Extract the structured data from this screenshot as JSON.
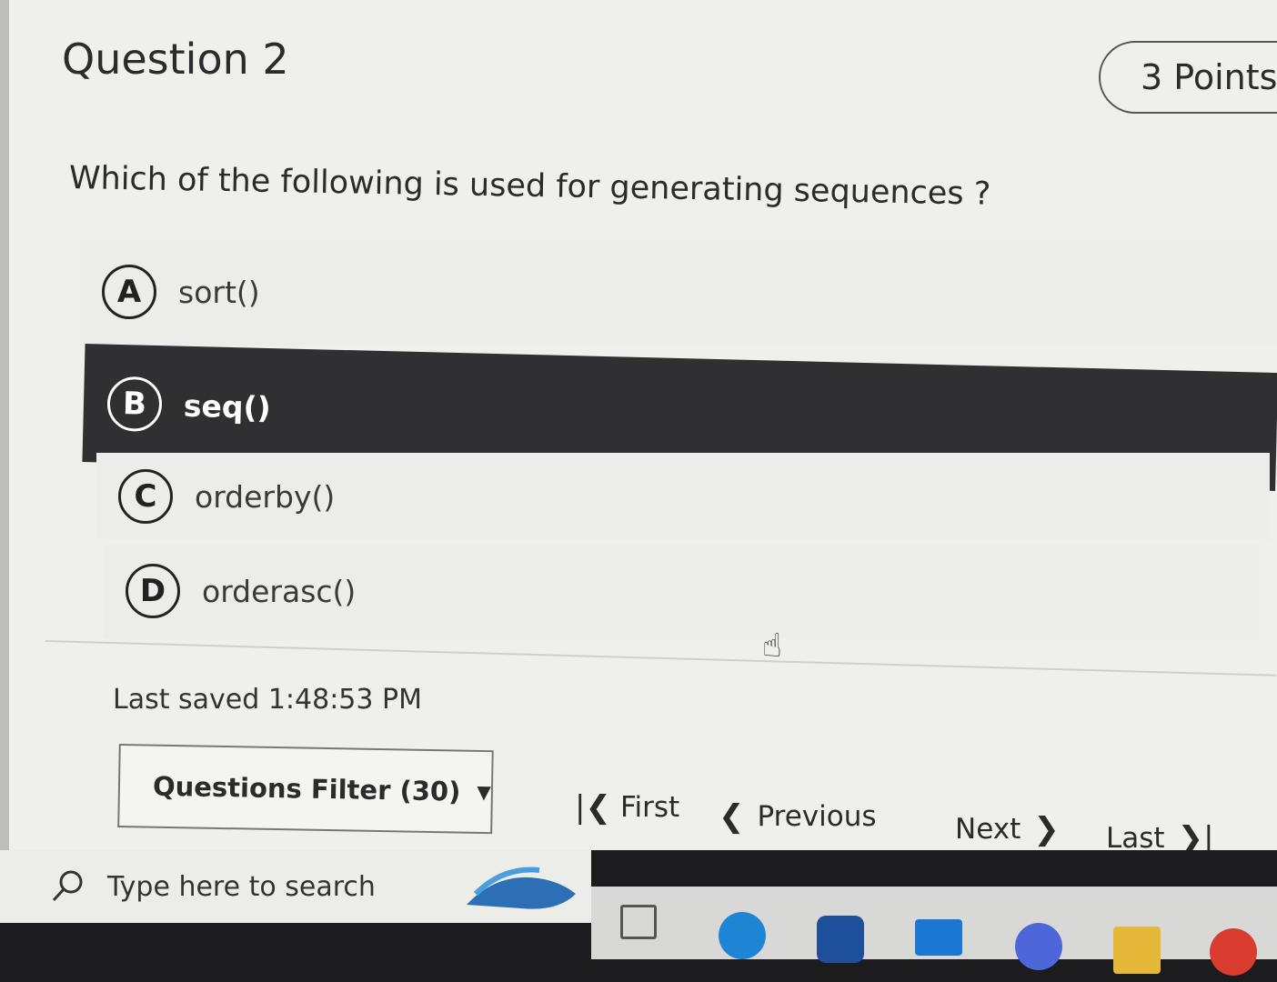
{
  "question": {
    "title": "Question 2",
    "points": "3 Points",
    "text": "Which of the following is used for generating sequences ?",
    "options": [
      {
        "letter": "A",
        "label": "sort()"
      },
      {
        "letter": "B",
        "label": "seq()"
      },
      {
        "letter": "C",
        "label": "orderby()"
      },
      {
        "letter": "D",
        "label": "orderasc()"
      }
    ],
    "selected": "B"
  },
  "footer": {
    "last_saved": "Last saved 1:48:53 PM",
    "filter_label": "Questions Filter (30)",
    "nav": {
      "first": "First",
      "previous": "Previous",
      "next": "Next",
      "last": "Last"
    }
  },
  "taskbar": {
    "search_placeholder": "Type here to search",
    "icons": [
      "task-view-icon",
      "edge-icon",
      "store-icon",
      "mail-icon",
      "copilot-icon",
      "file-explorer-icon",
      "chrome-icon"
    ]
  }
}
